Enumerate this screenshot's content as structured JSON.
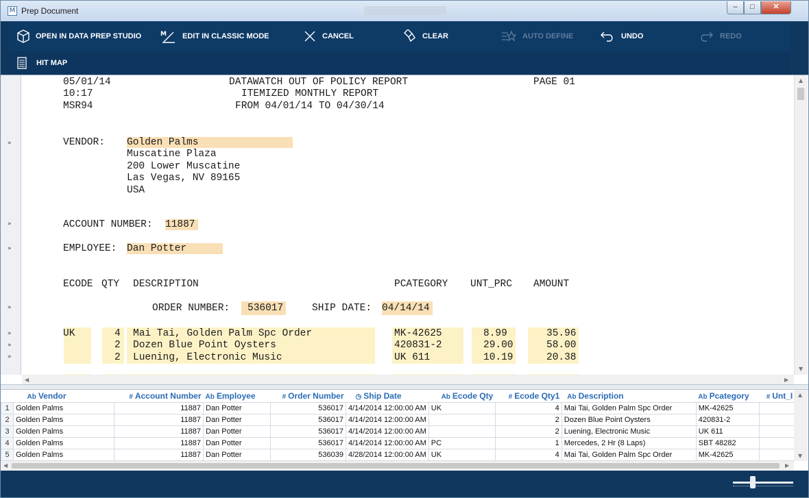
{
  "window": {
    "title": "Prep Document",
    "app_icon": "M",
    "icons": {
      "minimize": "minimize-icon",
      "maximize": "maximize-icon",
      "close": "close-icon"
    }
  },
  "toolbar": {
    "open_prep_studio": "OPEN IN DATA PREP STUDIO",
    "edit_classic": "EDIT IN CLASSIC MODE",
    "cancel": "CANCEL",
    "clear": "CLEAR",
    "auto_define": "AUTO DEFINE",
    "undo": "UNDO",
    "redo": "REDO",
    "hit_map": "HIT MAP"
  },
  "report": {
    "line1_date": "05/01/14",
    "line1_title": "DATAWATCH OUT OF POLICY REPORT",
    "line1_page": "PAGE 01",
    "line2_time": "10:17",
    "line2_sub": "ITEMIZED MONTHLY REPORT",
    "line3_code": "MSR94",
    "line3_range": "FROM 04/01/14 TO 04/30/14",
    "vendor_label": "VENDOR:",
    "vendor_name": "Golden Palms",
    "vendor_addr1": "Muscatine Plaza",
    "vendor_addr2": "200 Lower Muscatine",
    "vendor_addr3": "Las Vegas, NV 89165",
    "vendor_addr4": "USA",
    "account_label": "ACCOUNT NUMBER:",
    "account_value": "11887",
    "employee_label": "EMPLOYEE:",
    "employee_value": "Dan Potter",
    "hdr_ecode": "ECODE",
    "hdr_qty": "QTY",
    "hdr_desc": "DESCRIPTION",
    "hdr_pcat": "PCATEGORY",
    "hdr_unt": "UNT_PRC",
    "hdr_amount": "AMOUNT",
    "order_label": "ORDER NUMBER:",
    "order_value": "536017",
    "ship_label": "SHIP DATE:",
    "ship_value": "04/14/14",
    "items": [
      {
        "ecode": "UK",
        "qty": "4",
        "desc": "Mai Tai, Golden Palm Spc Order",
        "pcat": "MK-42625",
        "unt": "8.99",
        "amount": "35.96"
      },
      {
        "ecode": "",
        "qty": "2",
        "desc": "Dozen Blue Point Oysters",
        "pcat": "420831-2",
        "unt": "29.00",
        "amount": "58.00"
      },
      {
        "ecode": "",
        "qty": "2",
        "desc": "Luening, Electronic Music",
        "pcat": "UK 611",
        "unt": "10.19",
        "amount": "20.38"
      }
    ]
  },
  "grid": {
    "columns": [
      {
        "type": "Ab",
        "name": "Vendor"
      },
      {
        "type": "#",
        "name": "Account Number"
      },
      {
        "type": "Ab",
        "name": "Employee"
      },
      {
        "type": "#",
        "name": "Order Number"
      },
      {
        "type": "clock",
        "name": "Ship Date"
      },
      {
        "type": "Ab",
        "name": "Ecode Qty"
      },
      {
        "type": "#",
        "name": "Ecode Qty1"
      },
      {
        "type": "Ab",
        "name": "Description"
      },
      {
        "type": "Ab",
        "name": "Pcategory"
      },
      {
        "type": "#",
        "name": "Unt_I"
      }
    ],
    "rows": [
      {
        "n": "1",
        "vendor": "Golden Palms",
        "account": "11887",
        "employee": "Dan Potter",
        "order": "536017",
        "ship": "4/14/2014 12:00:00 AM",
        "ecode": "UK",
        "qty": "4",
        "desc": "Mai Tai, Golden Palm Spc Order",
        "pcat": "MK-42625"
      },
      {
        "n": "2",
        "vendor": "Golden Palms",
        "account": "11887",
        "employee": "Dan Potter",
        "order": "536017",
        "ship": "4/14/2014 12:00:00 AM",
        "ecode": "",
        "qty": "2",
        "desc": "Dozen Blue Point Oysters",
        "pcat": "420831-2"
      },
      {
        "n": "3",
        "vendor": "Golden Palms",
        "account": "11887",
        "employee": "Dan Potter",
        "order": "536017",
        "ship": "4/14/2014 12:00:00 AM",
        "ecode": "",
        "qty": "2",
        "desc": "Luening, Electronic Music",
        "pcat": "UK 611"
      },
      {
        "n": "4",
        "vendor": "Golden Palms",
        "account": "11887",
        "employee": "Dan Potter",
        "order": "536017",
        "ship": "4/14/2014 12:00:00 AM",
        "ecode": "PC",
        "qty": "1",
        "desc": "Mercedes, 2 Hr (8 Laps)",
        "pcat": "SBT 48282"
      },
      {
        "n": "5",
        "vendor": "Golden Palms",
        "account": "11887",
        "employee": "Dan Potter",
        "order": "536039",
        "ship": "4/28/2014 12:00:00 AM",
        "ecode": "UK",
        "qty": "4",
        "desc": "Mai Tai, Golden Palm Spc Order",
        "pcat": "MK-42625"
      }
    ]
  },
  "colors": {
    "toolbar_bg": "#0e3a66",
    "highlight_field": "#f9dfb5",
    "highlight_detail": "#fdf2c6",
    "header_blue": "#2b6cb5"
  }
}
